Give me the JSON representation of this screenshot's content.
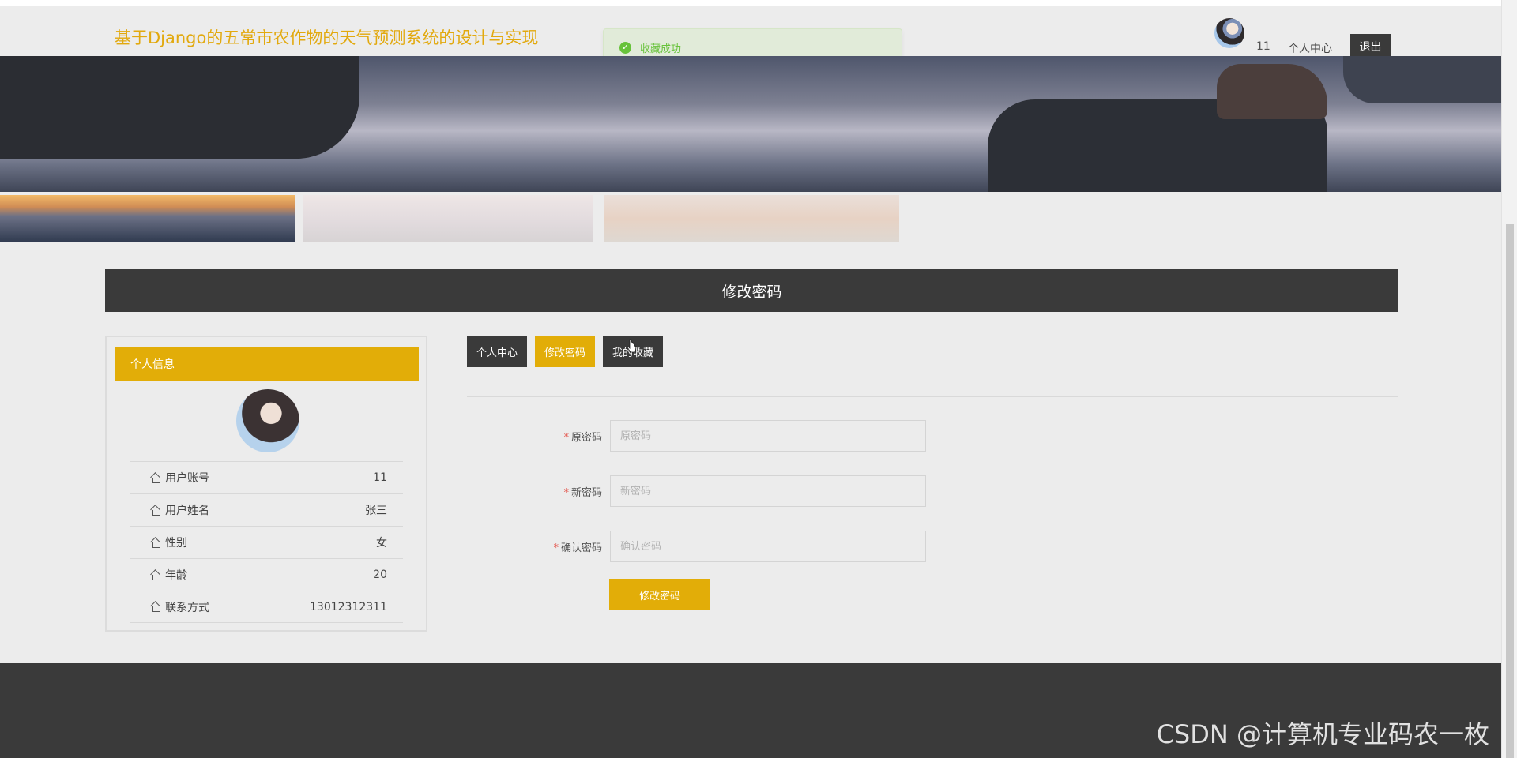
{
  "header": {
    "title": "基于Django的五常市农作物的天气预测系统的设计与实现",
    "username": "11",
    "personal_center": "个人中心",
    "logout": "退出"
  },
  "toast": {
    "message": "收藏成功",
    "icon": "check-circle-icon"
  },
  "section": {
    "title": "修改密码"
  },
  "profile": {
    "header": "个人信息",
    "rows": [
      {
        "label": "用户账号",
        "value": "11"
      },
      {
        "label": "用户姓名",
        "value": "张三"
      },
      {
        "label": "性别",
        "value": "女"
      },
      {
        "label": "年龄",
        "value": "20"
      },
      {
        "label": "联系方式",
        "value": "13012312311"
      }
    ]
  },
  "tabs": [
    {
      "label": "个人中心",
      "active": false
    },
    {
      "label": "修改密码",
      "active": true
    },
    {
      "label": "我的收藏",
      "active": false
    }
  ],
  "form": {
    "old_password": {
      "label": "原密码",
      "placeholder": "原密码"
    },
    "new_password": {
      "label": "新密码",
      "placeholder": "新密码"
    },
    "confirm_password": {
      "label": "确认密码",
      "placeholder": "确认密码"
    },
    "submit": "修改密码"
  },
  "watermark": "CSDN @计算机专业码农一枚",
  "colors": {
    "accent": "#e2ad08",
    "dark": "#3a3a3a",
    "title": "#e2a90e",
    "success": "#67c23a"
  }
}
